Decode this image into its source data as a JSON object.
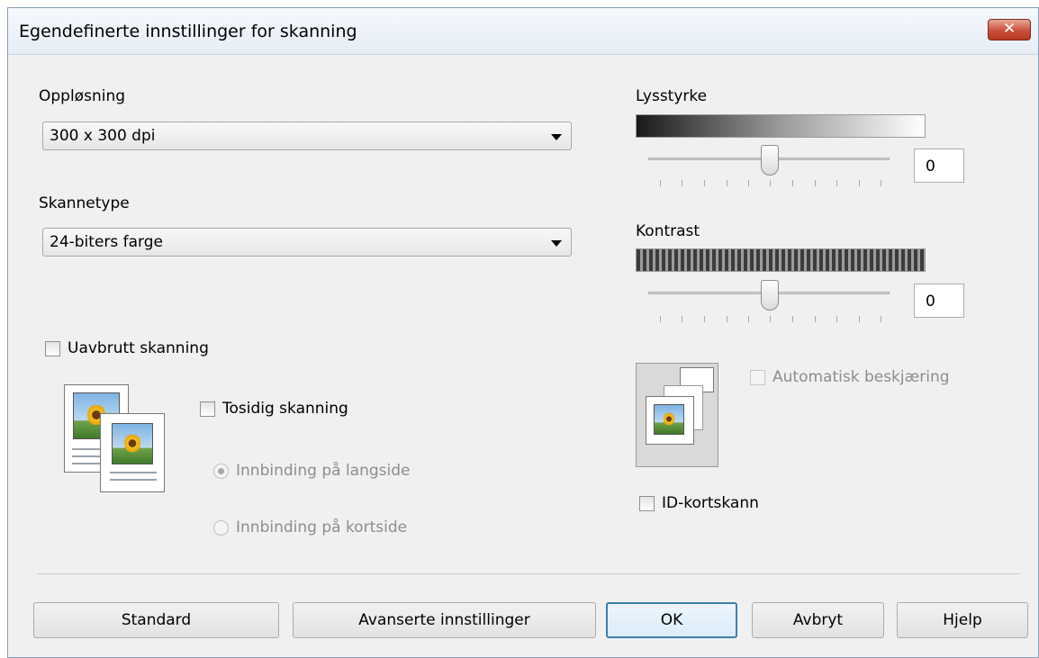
{
  "window": {
    "title": "Egendefinerte innstillinger for skanning",
    "close_glyph": "✕"
  },
  "resolution": {
    "label": "Oppløsning",
    "value": "300 x 300 dpi"
  },
  "scan_type": {
    "label": "Skannetype",
    "value": "24-biters farge"
  },
  "continuous": {
    "label": "Uavbrutt skanning",
    "checked": false
  },
  "duplex": {
    "label": "Tosidig skanning",
    "checked": false,
    "long_edge_label": "Innbinding på langside",
    "short_edge_label": "Innbinding på kortside"
  },
  "brightness": {
    "label": "Lysstyrke",
    "value": "0"
  },
  "contrast": {
    "label": "Kontrast",
    "value": "0"
  },
  "auto_crop": {
    "label": "Automatisk beskjæring",
    "enabled": false
  },
  "id_card": {
    "label": "ID-kortskann",
    "checked": false
  },
  "buttons": {
    "standard": "Standard",
    "advanced": "Avanserte innstillinger",
    "ok": "OK",
    "cancel": "Avbryt",
    "help": "Hjelp"
  }
}
